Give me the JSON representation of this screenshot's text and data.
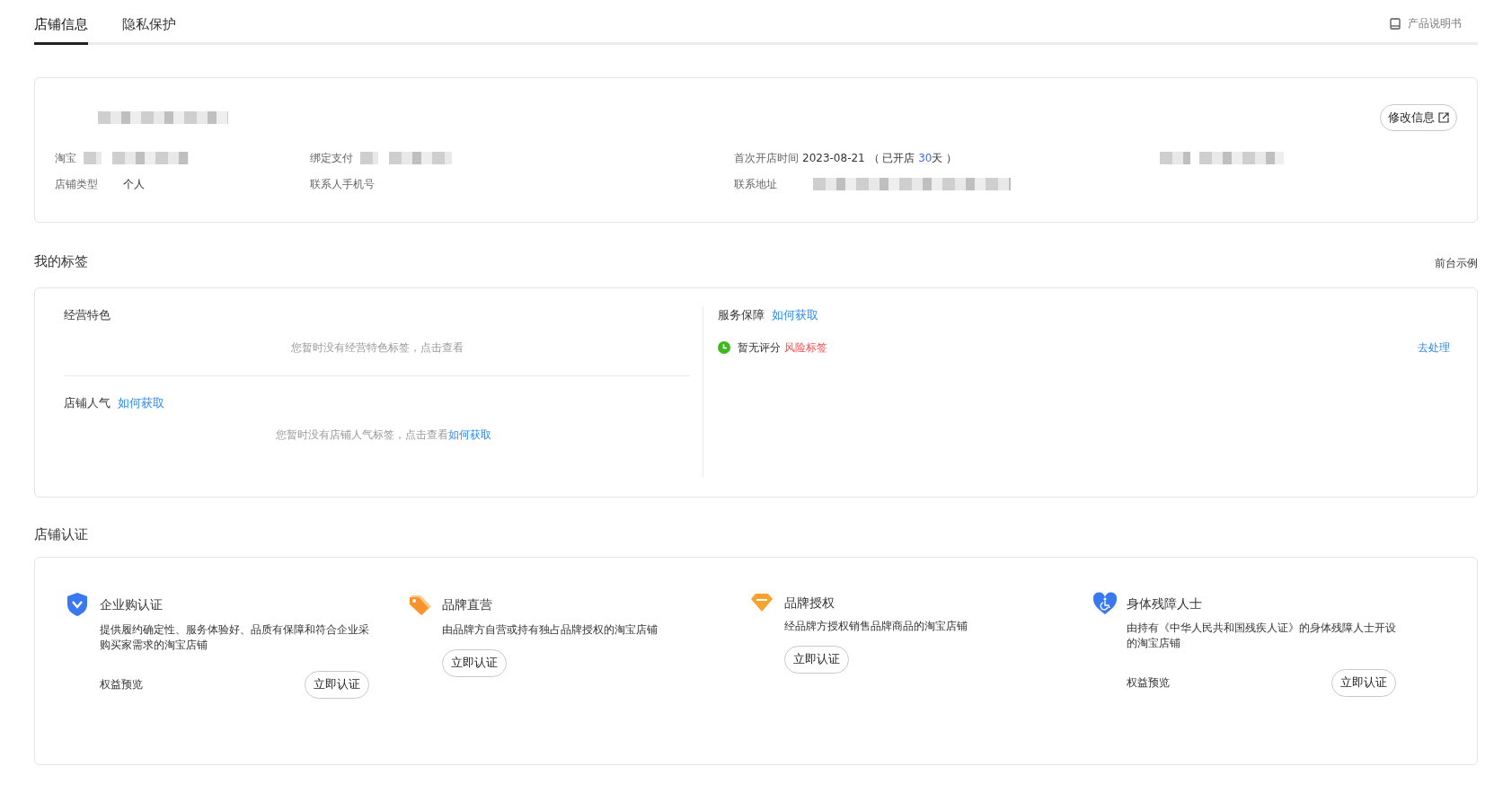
{
  "tabs": [
    {
      "label": "店铺信息",
      "selected": true
    },
    {
      "label": "隐私保护",
      "selected": false
    }
  ],
  "manual_link": "产品说明书",
  "shop_info": {
    "edit_button": "修改信息",
    "rows": [
      [
        {
          "kind": "masked",
          "label": "淘宝"
        },
        {
          "kind": "masked",
          "label": "绑定支付"
        },
        {
          "kind": "opened",
          "label": "首次开店时间",
          "value": "2023-08-21",
          "note_before": "（ 已开店",
          "days": "30",
          "note_after": "天 ）"
        },
        {
          "kind": "masked_all"
        }
      ],
      [
        {
          "kind": "text",
          "label": "店铺类型",
          "value": "个人"
        },
        {
          "kind": "text",
          "label": "联系人手机号"
        },
        {
          "kind": "masked",
          "label": "联系地址"
        }
      ]
    ]
  },
  "tags": {
    "title": "我的标签",
    "example_link": "前台示例",
    "left": [
      {
        "title": "经营特色",
        "empty_text": "您暂时没有经营特色标签，点击查看"
      },
      {
        "title": "店铺人气",
        "link": "如何获取",
        "empty_text": "您暂时没有店铺人气标签，点击查看",
        "empty_link": "如何获取"
      }
    ],
    "service": {
      "title": "服务保障",
      "link": "如何获取",
      "status": "暂无评分",
      "risk_tag": "风险标签",
      "action": "去处理"
    }
  },
  "certification": {
    "title": "店铺认证",
    "items": [
      {
        "kind": "shield",
        "name": "企业购认证",
        "description": "提供履约确定性、服务体验好、品质有保障和符合企业采购买家需求的淘宝店铺",
        "benefits": "权益预览",
        "button": "立即认证"
      },
      {
        "kind": "tag",
        "name": "品牌直营",
        "description": "由品牌方自营或持有独占品牌授权的淘宝店铺",
        "button": "立即认证"
      },
      {
        "kind": "gem",
        "name": "品牌授权",
        "description": "经品牌方授权销售品牌商品的淘宝店铺",
        "button": "立即认证"
      },
      {
        "kind": "heart",
        "name": "身体残障人士",
        "description": "由持有《中华人民共和国残疾人证》的身体残障人士开设的淘宝店铺",
        "benefits": "权益预览",
        "button": "立即认证"
      }
    ]
  }
}
